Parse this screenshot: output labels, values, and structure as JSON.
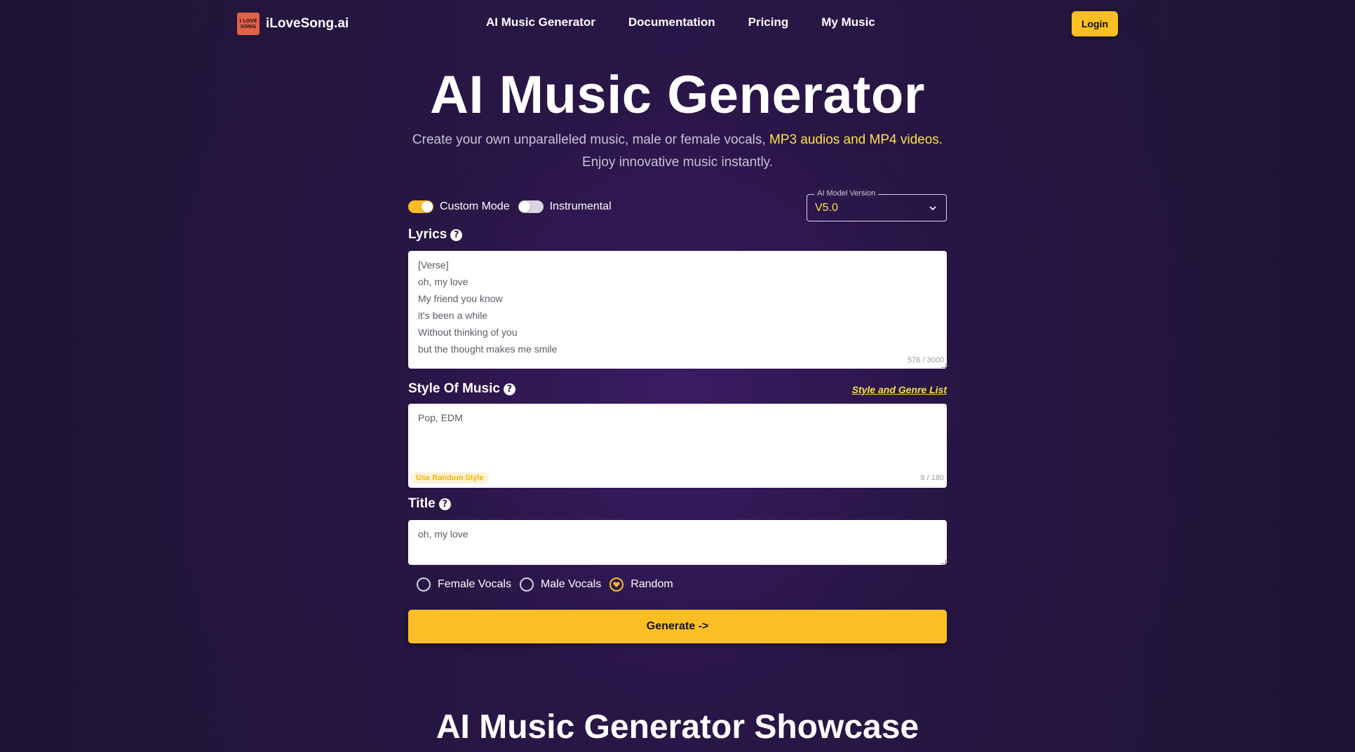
{
  "header": {
    "logo_mark_top": "I LOVE",
    "logo_mark_bottom": "SONG",
    "logo_text": "iLoveSong.ai",
    "nav": [
      "AI Music Generator",
      "Documentation",
      "Pricing",
      "My Music"
    ],
    "login_label": "Login"
  },
  "hero": {
    "title": "AI Music Generator",
    "subtitle_plain": "Create your own unparalleled music, male or female vocals, ",
    "subtitle_highlight": "MP3 audios and MP4 videos.",
    "subtitle_line2": "Enjoy innovative music instantly."
  },
  "form": {
    "custom_mode_label": "Custom Mode",
    "custom_mode_on": true,
    "instrumental_label": "Instrumental",
    "instrumental_on": false,
    "model_legend": "AI Model Version",
    "model_value": "V5.0",
    "lyrics_label": "Lyrics",
    "lyrics_value": "[Verse]\noh, my love\nMy friend you know\nit's been a while\nWithout thinking of you\nbut the thought makes me smile",
    "lyrics_counter": "576 / 3000",
    "style_label": "Style Of Music",
    "style_link": "Style and Genre List",
    "style_value": "Pop, EDM",
    "random_style_label": "Use Random Style",
    "style_counter": "8 / 180",
    "title_label": "Title",
    "title_value": "oh, my love",
    "vocals": [
      "Female Vocals",
      "Male Vocals",
      "Random"
    ],
    "vocals_selected": "Random",
    "generate_label": "Generate ->"
  },
  "showcase": {
    "title": "AI Music Generator Showcase"
  },
  "colors": {
    "accent": "#fbbf24",
    "highlight": "#fde047",
    "background": "#2a1846"
  }
}
